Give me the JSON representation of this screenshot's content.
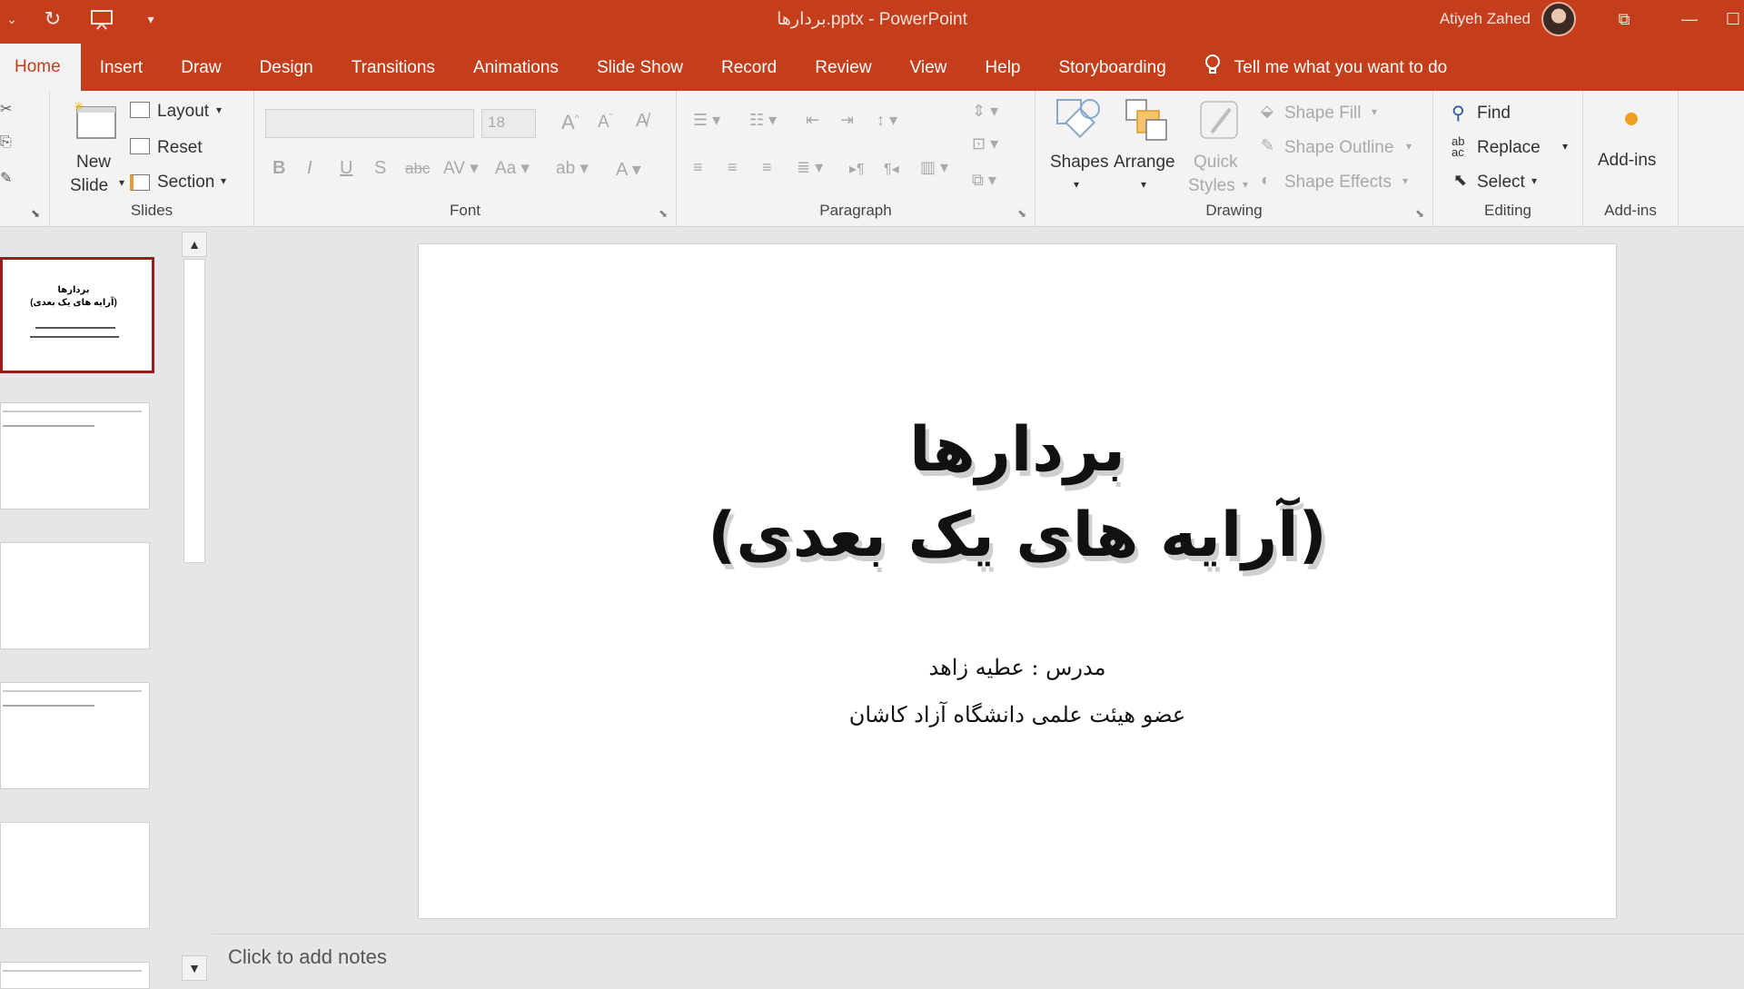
{
  "app": {
    "title": "بردارها.pptx  -  PowerPoint",
    "user": "Atiyeh Zahed"
  },
  "tabs": [
    "Home",
    "Insert",
    "Draw",
    "Design",
    "Transitions",
    "Animations",
    "Slide Show",
    "Record",
    "Review",
    "View",
    "Help",
    "Storyboarding"
  ],
  "tell_me": "Tell me what you want to do",
  "ribbon": {
    "slides": {
      "new_slide": "New",
      "new_slide2": "Slide",
      "layout": "Layout",
      "reset": "Reset",
      "section": "Section",
      "label": "Slides"
    },
    "font": {
      "size": "18",
      "label": "Font"
    },
    "paragraph": {
      "label": "Paragraph"
    },
    "drawing": {
      "shapes": "Shapes",
      "arrange": "Arrange",
      "quick": "Quick",
      "styles": "Styles",
      "fill": "Shape Fill",
      "outline": "Shape Outline",
      "effects": "Shape Effects",
      "label": "Drawing"
    },
    "editing": {
      "find": "Find",
      "replace": "Replace",
      "select": "Select",
      "label": "Editing"
    },
    "addins": {
      "button": "Add-ins",
      "label": "Add-ins"
    }
  },
  "slide": {
    "title_line1": "بردارها",
    "title_line2": "(آرایه های یک بعدی)",
    "sub_line1": "مدرس : عطیه زاهد",
    "sub_line2": "عضو هیئت علمی دانشگاه آزاد کاشان"
  },
  "notes_placeholder": "Click to add notes",
  "colors": {
    "accent": "#c43e1c",
    "selected_thumb": "#9b1b1b"
  }
}
